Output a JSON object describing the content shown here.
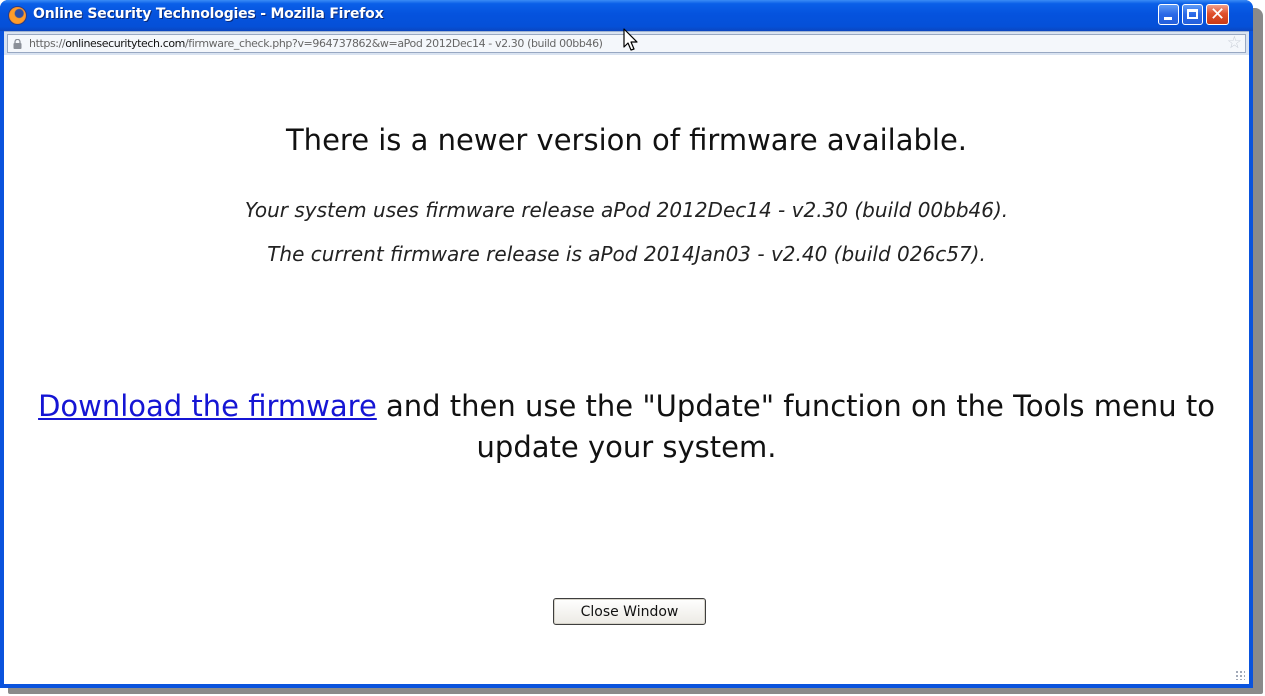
{
  "window": {
    "title": "Online Security Technologies - Mozilla Firefox",
    "controls": [
      "minimize",
      "maximize",
      "close"
    ]
  },
  "address_bar": {
    "scheme": "https://",
    "host": "onlinesecuritytech.com",
    "path": "/firmware_check.php?v=964737862&w=aPod 2012Dec14 - v2.30 (build 00bb46)",
    "lock_icon": "lock-icon",
    "bookmark_icon": "star-icon"
  },
  "page": {
    "heading": "There is a newer version of firmware available.",
    "current_line": "Your system uses firmware release aPod 2012Dec14 - v2.30 (build 00bb46).",
    "latest_line": "The current firmware release is aPod 2014Jan03 - v2.40 (build 026c57).",
    "download_link": "Download the firmware",
    "instruction_rest": " and then use the \"Update\" function on the Tools menu to update your system.",
    "close_button": "Close Window"
  },
  "colors": {
    "titlebar": "#0553de",
    "link": "#1515d4",
    "close_button_red": "#e0502c"
  }
}
